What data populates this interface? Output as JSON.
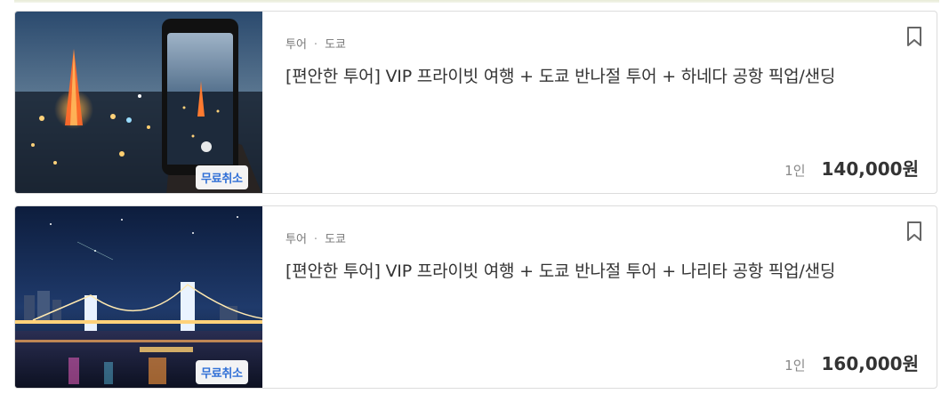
{
  "listings": [
    {
      "category": "투어",
      "city": "도쿄",
      "title": "[편안한 투어] VIP 프라이빗 여행 + 도쿄 반나절 투어 + 하네다 공항 픽업/샌딩",
      "badge": "무료취소",
      "price_unit": "1인",
      "price": "140,000원",
      "image": "tokyo-tower-night-phone-photo"
    },
    {
      "category": "투어",
      "city": "도쿄",
      "title": "[편안한 투어] VIP 프라이빗 여행 + 도쿄 반나절 투어 + 나리타 공항 픽업/샌딩",
      "badge": "무료취소",
      "price_unit": "1인",
      "price": "160,000원",
      "image": "rainbow-bridge-night"
    }
  ],
  "icons": {
    "bookmark": "bookmark-icon"
  },
  "colors": {
    "badge_text": "#2f6fd6",
    "price_text": "#333333"
  }
}
